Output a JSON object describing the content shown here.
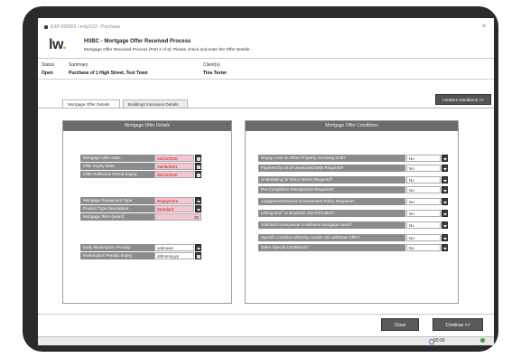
{
  "breadcrumb": "EXP-000002 / enty/123 - Purchase",
  "logo": {
    "text": "lw",
    "accent": "."
  },
  "process": {
    "title": "HSBC - Mortgage Offer Received Process",
    "subtitle": "Mortgage Offer Received Process (Part 2 of 5): Please check and enter the Offer Details -"
  },
  "info": {
    "status_label": "Status",
    "status_value": "Open",
    "summary_label": "Summary",
    "summary_value": "Purchase of 1 High Street, Test Town",
    "client_label": "Client(s)",
    "client_value": "Tina Tester"
  },
  "tabs": [
    {
      "label": "Mortgage Offer Details"
    },
    {
      "label": "Buildings Insurance Details"
    }
  ],
  "lenders_button": "Lenders Handbook >>",
  "details": {
    "header": "Mortgage Offer Details",
    "dates": [
      {
        "label": "Mortgage Offer Date:",
        "value": "16/12/2020"
      },
      {
        "label": "Offer Expiry Date:",
        "value": "16/06/2021"
      },
      {
        "label": "Offer Reflection Period Expiry:",
        "value": "30/12/2020"
      }
    ],
    "repayment_type": {
      "label": "Mortgage Repayment Type:",
      "value": "Repayment"
    },
    "product_type": {
      "label": "Product Type Description:",
      "value": "Standard"
    },
    "term": {
      "label": "Mortgage Term (years):",
      "value": "25"
    },
    "early_redemption": {
      "label": "Early Redemption Penalty:",
      "value": "unknown"
    },
    "redemption_expiry": {
      "label": "Redemption Penalty Expiry:",
      "value": "dd/mm/yyyy"
    }
  },
  "conditions": {
    "header": "Mortgage Offer Conditions",
    "items": [
      {
        "label": "Repay Loan on Other Property not being Sold?",
        "value": "No"
      },
      {
        "label": "Payment by Us of Unsecured Debt Required?",
        "value": "No"
      },
      {
        "label": "Undertaking for Minor Works Required?",
        "value": "No"
      },
      {
        "label": "Pre-Completion Reinspection Required?",
        "value": "No"
      },
      {
        "label": "Assignment/Deposit of Investment Policy Required?",
        "value": "No"
      },
      {
        "label": "Letting and / or Business Use Permitted?",
        "value": "No"
      },
      {
        "label": "Solicitor/Conveyancer to Witness Mortgage Deed?",
        "value": "No"
      },
      {
        "label": "Specific condition whereby Lender can withdraw Offer?",
        "value": "No"
      },
      {
        "label": "Other Special Conditions?",
        "value": "No"
      }
    ]
  },
  "footer": {
    "close": "Close",
    "continue": "Continue >>"
  },
  "statusbar": {
    "timer": "00:00"
  }
}
